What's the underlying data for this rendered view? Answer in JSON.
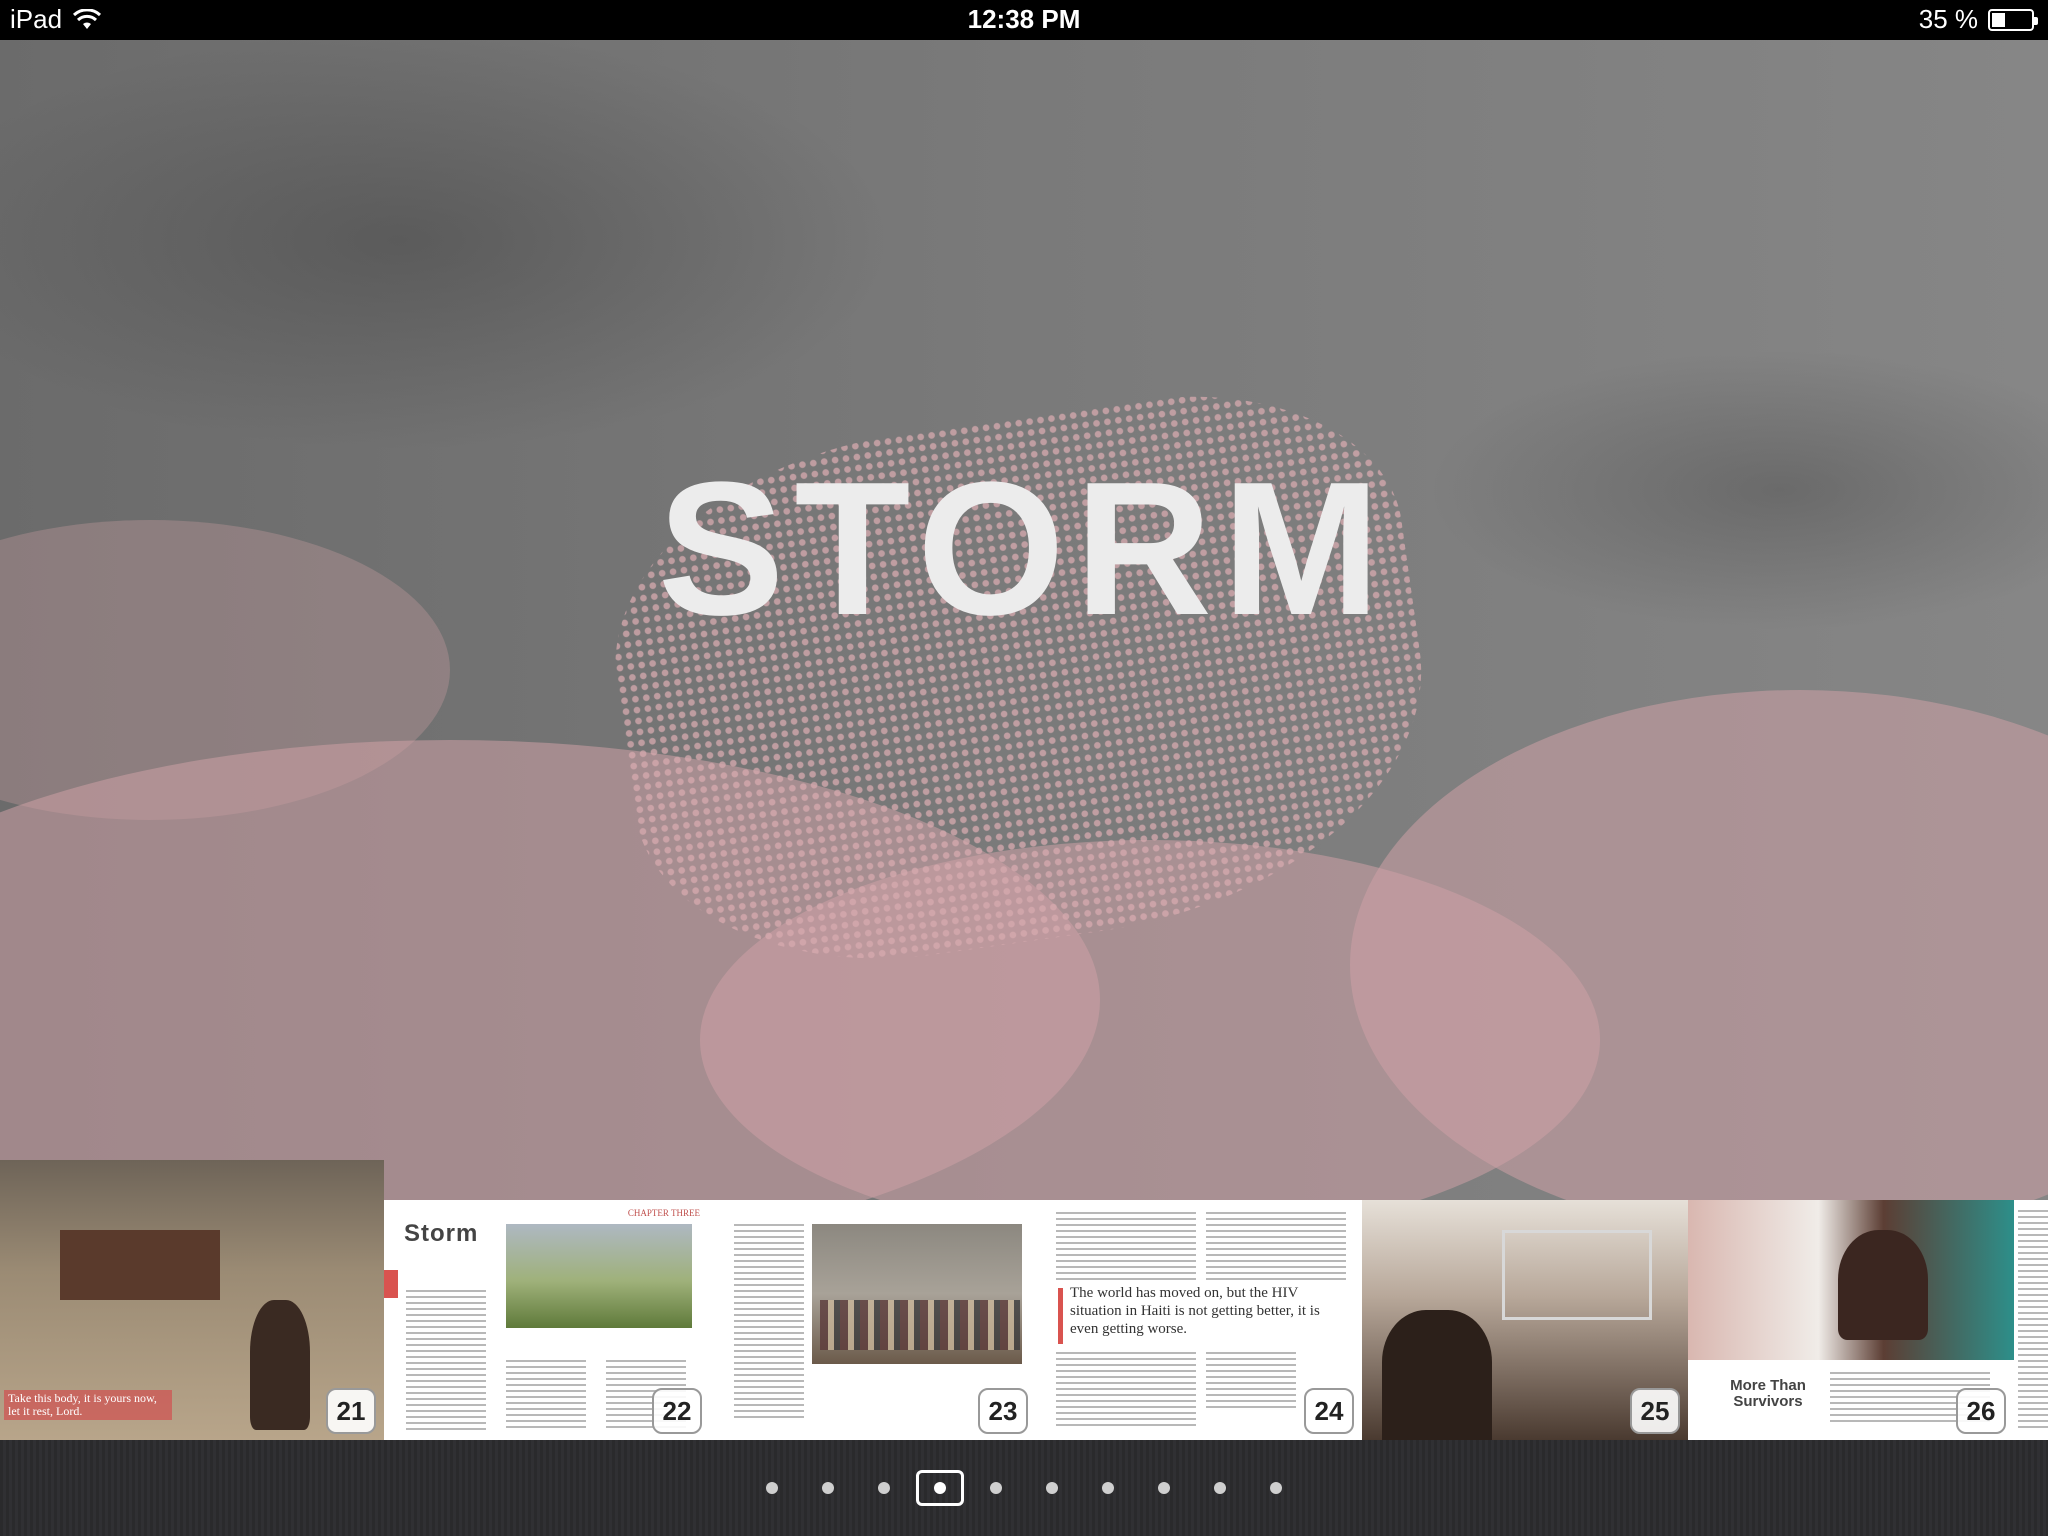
{
  "status_bar": {
    "device": "iPad",
    "time": "12:38 PM",
    "battery_text": "35 %",
    "battery_level": 0.35
  },
  "page": {
    "title": "STORM"
  },
  "thumbnails": [
    {
      "number": "21",
      "caption": "Take this body, it is yours now, let it rest, Lord."
    },
    {
      "number": "22",
      "heading": "Storm",
      "chapter": "CHAPTER THREE"
    },
    {
      "number": "23"
    },
    {
      "number": "24",
      "quote": "The world has moved on, but the HIV situation in Haiti is not getting better, it is even getting worse."
    },
    {
      "number": "25"
    },
    {
      "number": "26",
      "heading": "More Than Survivors"
    }
  ],
  "pager": {
    "count": 10,
    "active_index": 3
  },
  "colors": {
    "accent_pink": "#d7a9ae",
    "red_rule": "#d9534f"
  }
}
